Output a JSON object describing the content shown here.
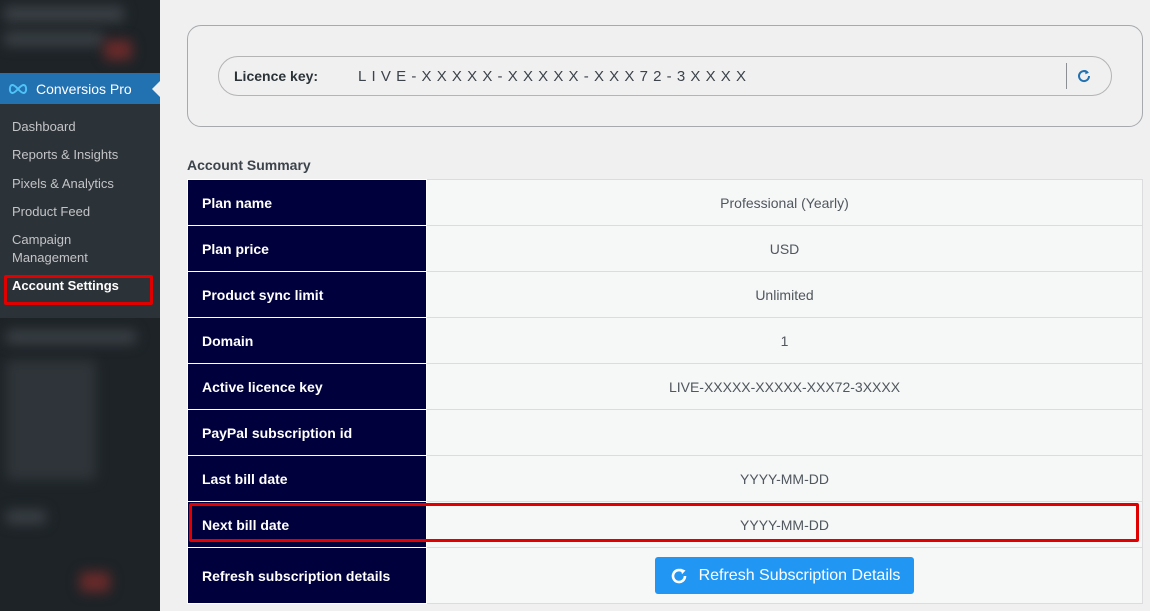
{
  "sidebar": {
    "brand": "Conversios Pro",
    "items": [
      {
        "label": "Dashboard"
      },
      {
        "label": "Reports & Insights"
      },
      {
        "label": "Pixels & Analytics"
      },
      {
        "label": "Product Feed"
      },
      {
        "label": "Campaign Management"
      },
      {
        "label": "Account Settings",
        "active": true
      }
    ]
  },
  "licence": {
    "label": "Licence key:",
    "value": "LIVE-XXXXX-XXXXX-XXX72-3XXXX"
  },
  "summary": {
    "title": "Account Summary",
    "rows": [
      {
        "key": "Plan name",
        "value": "Professional (Yearly)"
      },
      {
        "key": "Plan price",
        "value": "USD"
      },
      {
        "key": "Product sync limit",
        "value": "Unlimited"
      },
      {
        "key": "Domain",
        "value": "1"
      },
      {
        "key": "Active licence key",
        "value": "LIVE-XXXXX-XXXXX-XXX72-3XXXX"
      },
      {
        "key": "PayPal subscription id",
        "value": ""
      },
      {
        "key": "Last bill date",
        "value": "YYYY-MM-DD"
      },
      {
        "key": "Next bill date",
        "value": "YYYY-MM-DD"
      },
      {
        "key": "Refresh subscription details",
        "button": "Refresh Subscription Details"
      }
    ]
  },
  "colors": {
    "accent": "#2271b1",
    "table_key_bg": "#00003c",
    "button": "#2196f3",
    "highlight": "#e00000"
  },
  "icons": {
    "brand": "infinity-icon",
    "licence_refresh": "refresh-icon",
    "button_refresh": "refresh-icon"
  }
}
